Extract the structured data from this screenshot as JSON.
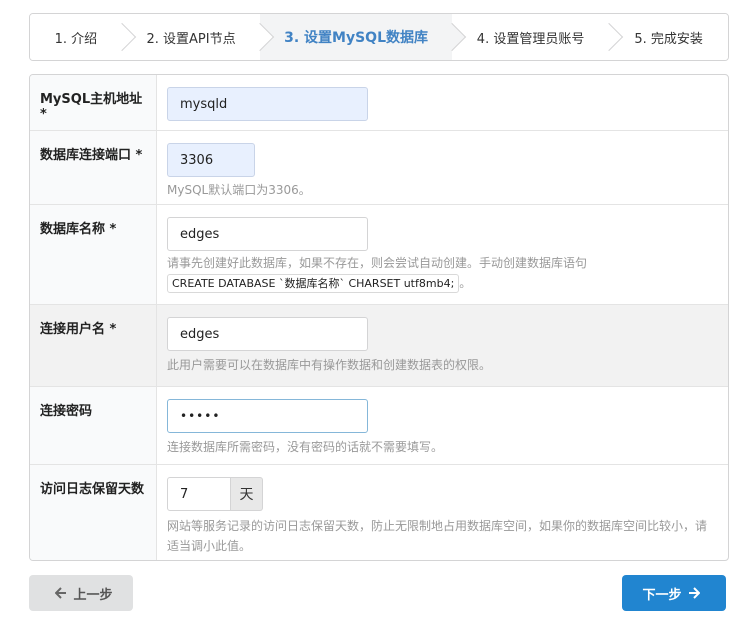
{
  "steps": [
    {
      "label": "1. 介绍"
    },
    {
      "label": "2. 设置API节点"
    },
    {
      "label": "3. 设置MySQL数据库"
    },
    {
      "label": "4. 设置管理员账号"
    },
    {
      "label": "5. 完成安装"
    }
  ],
  "fields": {
    "host": {
      "label": "MySQL主机地址 *",
      "value": "mysqld"
    },
    "port": {
      "label": "数据库连接端口 *",
      "value": "3306",
      "hint": "MySQL默认端口为3306。"
    },
    "dbname": {
      "label": "数据库名称 *",
      "value": "edges",
      "hint": "请事先创建好此数据库，如果不存在，则会尝试自动创建。手动创建数据库语句",
      "code": "CREATE DATABASE `数据库名称` CHARSET utf8mb4;",
      "hint_end": "。"
    },
    "user": {
      "label": "连接用户名 *",
      "value": "edges",
      "hint": "此用户需要可以在数据库中有操作数据和创建数据表的权限。"
    },
    "password": {
      "label": "连接密码",
      "value": "•••••",
      "hint": "连接数据库所需密码，没有密码的话就不需要填写。"
    },
    "logdays": {
      "label": "访问日志保留天数",
      "value": "7",
      "unit": "天",
      "hint": "网站等服务记录的访问日志保留天数，防止无限制地占用数据库空间，如果你的数据库空间比较小，请适当调小此值。"
    }
  },
  "buttons": {
    "prev": "上一步",
    "next": "下一步"
  },
  "colors": {
    "accent": "#2185d0",
    "active_step": "#4183c4"
  }
}
